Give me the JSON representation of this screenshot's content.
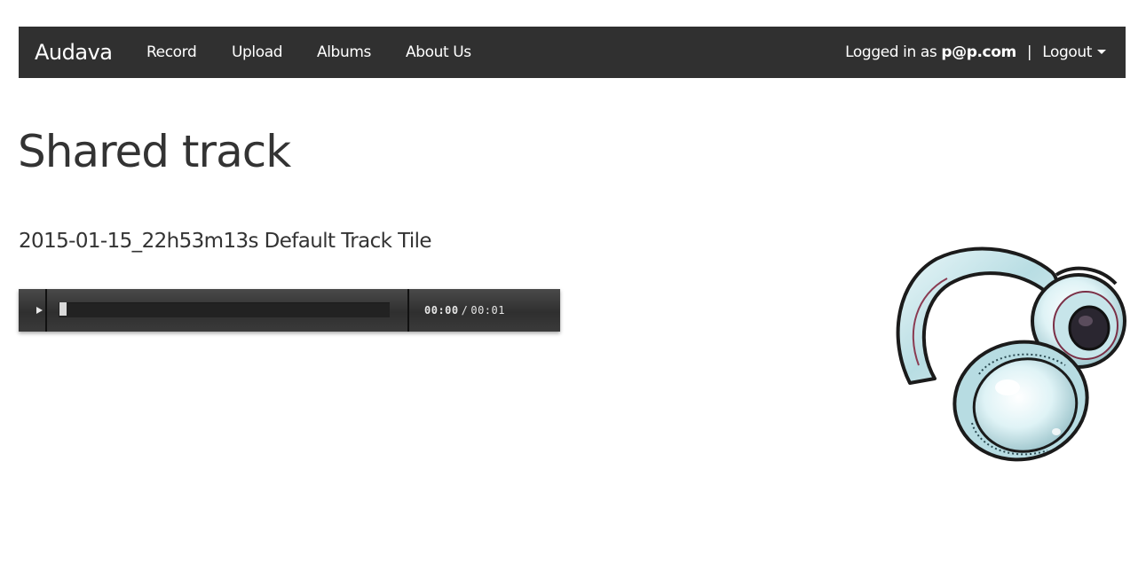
{
  "nav": {
    "brand": "Audava",
    "links": [
      "Record",
      "Upload",
      "Albums",
      "About Us"
    ],
    "logged_in_prefix": "Logged in as",
    "user_email": "p@p.com",
    "separator": "|",
    "logout_label": "Logout"
  },
  "page": {
    "title": "Shared track"
  },
  "track": {
    "name": "2015-01-15_22h53m13s Default Track Tile",
    "current_time": "00:00",
    "time_separator": "/",
    "duration": "00:01",
    "progress": 0
  },
  "icons": {
    "play": "play-icon",
    "dropdown": "caret-down-icon",
    "artwork": "headphones-illustration"
  },
  "colors": {
    "navbar_bg": "#303030",
    "player_bg": "#3a3a3a",
    "text": "#333333"
  }
}
